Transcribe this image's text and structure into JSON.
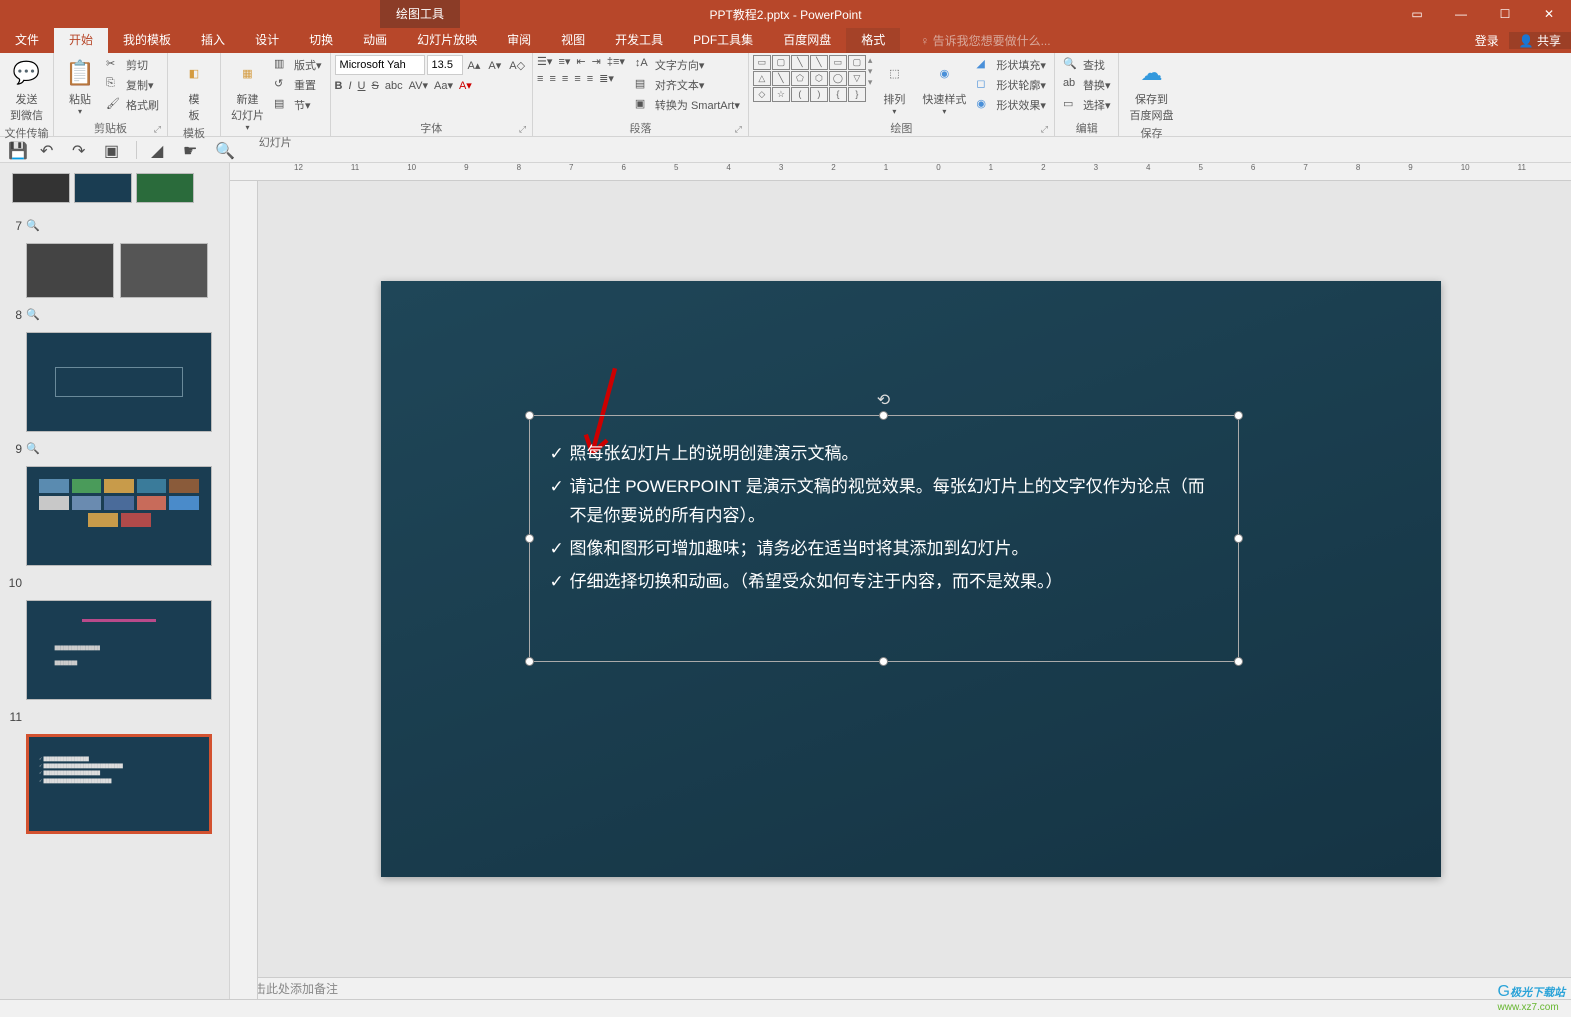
{
  "title": "PPT教程2.pptx - PowerPoint",
  "drawing_tools": "绘图工具",
  "win": {
    "login": "登录",
    "share": "共享"
  },
  "tabs": {
    "file": "文件",
    "home": "开始",
    "mytpl": "我的模板",
    "insert": "插入",
    "design": "设计",
    "transition": "切换",
    "animation": "动画",
    "slideshow": "幻灯片放映",
    "review": "审阅",
    "view": "视图",
    "dev": "开发工具",
    "pdf": "PDF工具集",
    "baidu": "百度网盘",
    "format": "格式",
    "tell": "告诉我您想要做什么..."
  },
  "groups": {
    "filetransfer": {
      "label": "文件传输",
      "btn": "发送\n到微信"
    },
    "clipboard": {
      "label": "剪贴板",
      "paste": "粘贴",
      "cut": "剪切",
      "copy": "复制",
      "painter": "格式刷"
    },
    "template": {
      "label": "模板",
      "btn": "模\n板"
    },
    "slides": {
      "label": "幻灯片",
      "new": "新建\n幻灯片",
      "layout": "版式",
      "reset": "重置",
      "section": "节"
    },
    "font": {
      "label": "字体",
      "name": "Microsoft Yah",
      "size": "13.5"
    },
    "paragraph": {
      "label": "段落",
      "dir": "文字方向",
      "align": "对齐文本",
      "smart": "转换为 SmartArt"
    },
    "drawing": {
      "label": "绘图",
      "arrange": "排列",
      "quick": "快速样式",
      "fill": "形状填充",
      "outline": "形状轮廓",
      "effects": "形状效果"
    },
    "editing": {
      "label": "编辑",
      "find": "查找",
      "replace": "替换",
      "select": "选择"
    },
    "save": {
      "label": "保存",
      "btn": "保存到\n百度网盘"
    }
  },
  "slide": {
    "b1": "照每张幻灯片上的说明创建演示文稿。",
    "b2": "请记住 POWERPOINT 是演示文稿的视觉效果。每张幻灯片上的文字仅作为论点（而不是你要说的所有内容）。",
    "b3": "图像和图形可增加趣味；请务必在适当时将其添加到幻灯片。",
    "b4": "仔细选择切换和动画。（希望受众如何专注于内容，而不是效果。）"
  },
  "thumbs": {
    "nums": [
      "7",
      "8",
      "9",
      "10",
      "11"
    ]
  },
  "notes": "单击此处添加备注",
  "watermark": {
    "t1": "极光下载站",
    "t2": "www.xz7.com"
  }
}
